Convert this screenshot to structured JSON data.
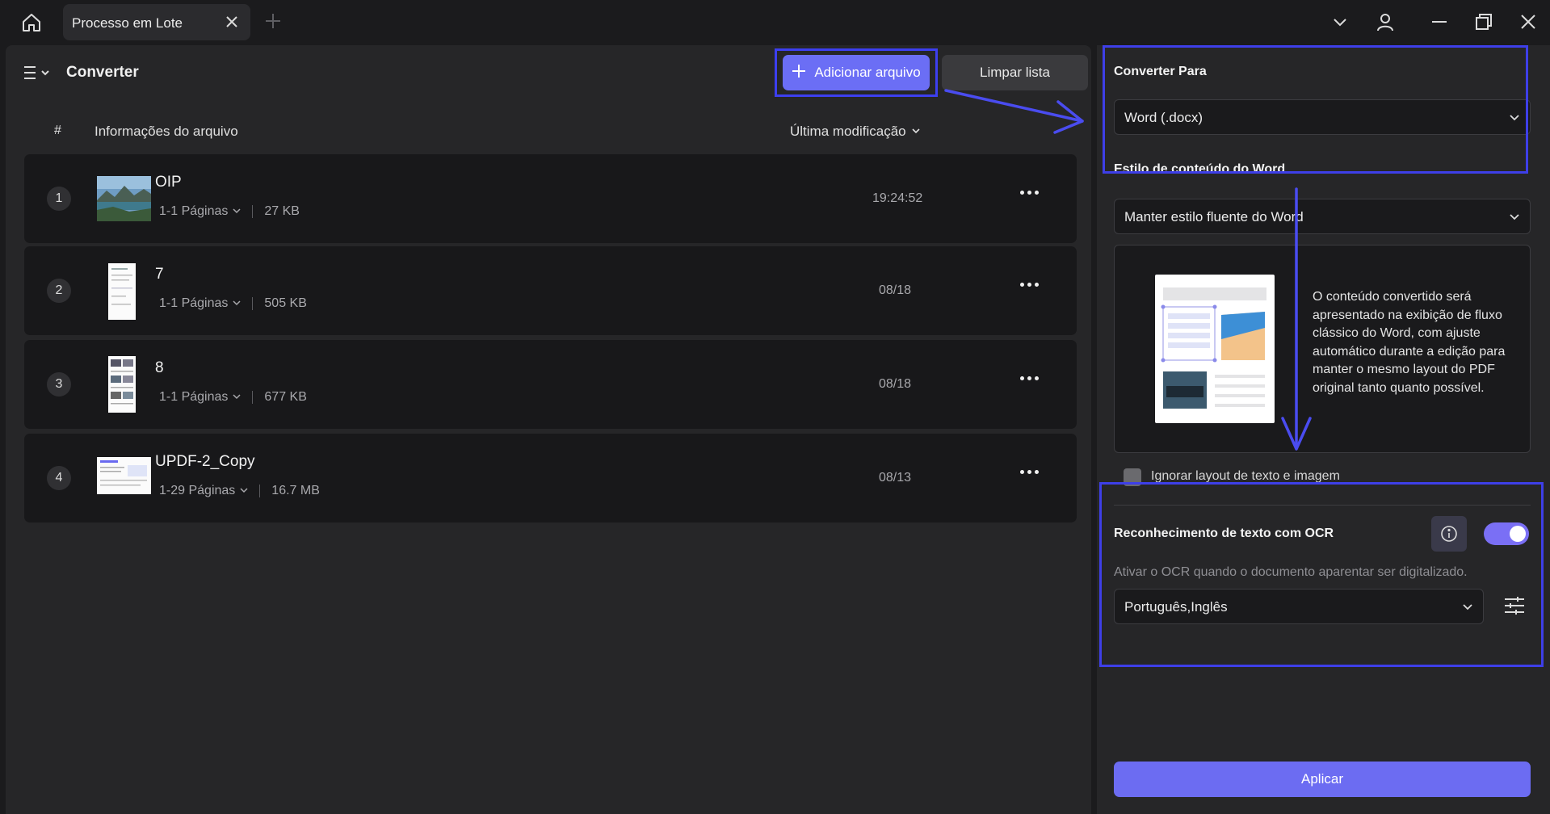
{
  "titlebar": {
    "tab_label": "Processo em Lote"
  },
  "header": {
    "title": "Converter",
    "add_button": "Adicionar arquivo",
    "clear_button": "Limpar lista"
  },
  "table": {
    "col_num": "#",
    "col_info": "Informações do arquivo",
    "col_modified": "Última modificação"
  },
  "files": [
    {
      "num": "1",
      "name": "OIP",
      "pages": "1-1 Páginas",
      "size": "27 KB",
      "date": "19:24:52"
    },
    {
      "num": "2",
      "name": "7",
      "pages": "1-1 Páginas",
      "size": "505 KB",
      "date": "08/18"
    },
    {
      "num": "3",
      "name": "8",
      "pages": "1-1 Páginas",
      "size": "677 KB",
      "date": "08/18"
    },
    {
      "num": "4",
      "name": "UPDF-2_Copy",
      "pages": "1-29 Páginas",
      "size": "16.7 MB",
      "date": "08/13"
    }
  ],
  "settings": {
    "convert_to_label": "Converter Para",
    "convert_to_value": "Word (.docx)",
    "style_label": "Estilo de conteúdo do Word",
    "style_value": "Manter estilo fluente do Word",
    "style_description": "O conteúdo convertido será apresentado na exibição de fluxo clássico do Word, com ajuste automático durante a edição para manter o mesmo layout do PDF original tanto quanto possível.",
    "ignore_layout_label": "Ignorar layout de texto e imagem",
    "ocr_label": "Reconhecimento de texto com OCR",
    "ocr_enabled": true,
    "ocr_hint": "Ativar o OCR quando o documento aparentar ser digitalizado.",
    "ocr_language": "Português,Inglês",
    "apply_button": "Aplicar"
  },
  "colors": {
    "accent": "#6b6ef5",
    "annotation": "#3e3fe8",
    "background": "#1b1b1d",
    "panel": "#262628"
  }
}
